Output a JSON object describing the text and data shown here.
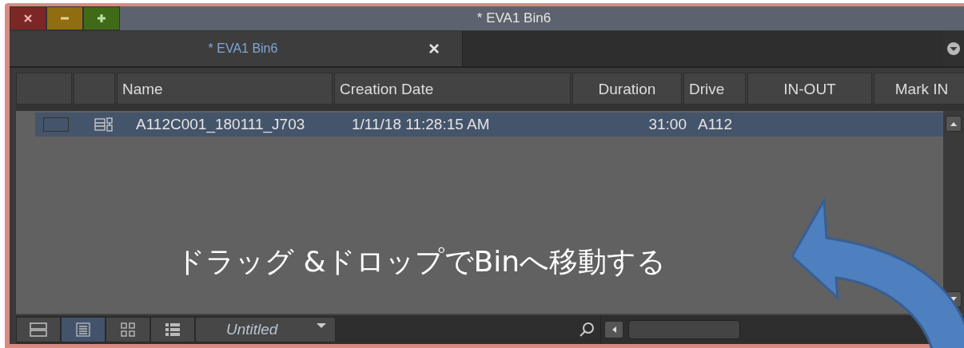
{
  "window": {
    "title": "* EVA1 Bin6"
  },
  "tabs": [
    {
      "label": "* EVA1 Bin6",
      "selected": true,
      "close": "×"
    }
  ],
  "table": {
    "columns": [
      "Name",
      "Creation Date",
      "Duration",
      "Drive",
      "IN-OUT",
      "Mark IN"
    ],
    "rows": [
      {
        "selected": true,
        "cells": [
          "A112C001_180111_J703",
          "1/11/18 11:28:15 AM",
          "31:00",
          "A112",
          "",
          ""
        ]
      }
    ]
  },
  "annotation": "ドラッグ &ドロップでBinへ移動する",
  "view_modes": [
    {
      "kind": "frame",
      "selected": false
    },
    {
      "kind": "text",
      "selected": true
    },
    {
      "kind": "grid",
      "selected": false
    },
    {
      "kind": "script",
      "selected": false
    }
  ],
  "bin_view": {
    "value": "Untitled"
  }
}
